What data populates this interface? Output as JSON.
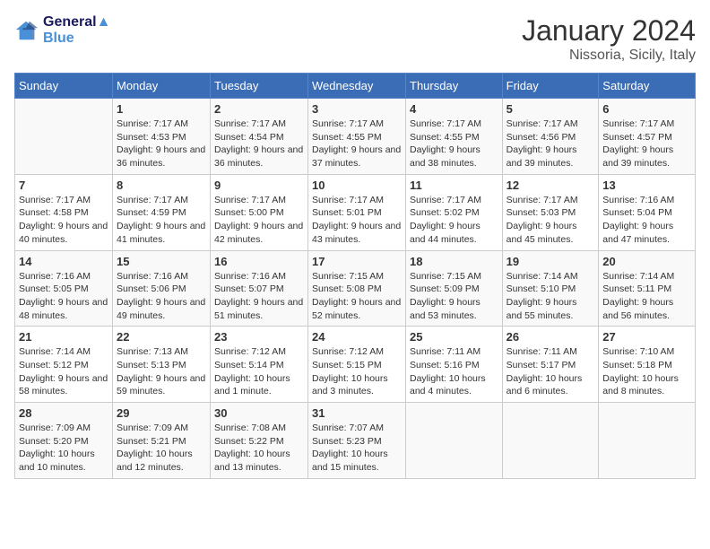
{
  "header": {
    "logo_line1": "General",
    "logo_line2": "Blue",
    "month": "January 2024",
    "location": "Nissoria, Sicily, Italy"
  },
  "weekdays": [
    "Sunday",
    "Monday",
    "Tuesday",
    "Wednesday",
    "Thursday",
    "Friday",
    "Saturday"
  ],
  "weeks": [
    [
      {
        "day": "",
        "sunrise": "",
        "sunset": "",
        "daylight": ""
      },
      {
        "day": "1",
        "sunrise": "Sunrise: 7:17 AM",
        "sunset": "Sunset: 4:53 PM",
        "daylight": "Daylight: 9 hours and 36 minutes."
      },
      {
        "day": "2",
        "sunrise": "Sunrise: 7:17 AM",
        "sunset": "Sunset: 4:54 PM",
        "daylight": "Daylight: 9 hours and 36 minutes."
      },
      {
        "day": "3",
        "sunrise": "Sunrise: 7:17 AM",
        "sunset": "Sunset: 4:55 PM",
        "daylight": "Daylight: 9 hours and 37 minutes."
      },
      {
        "day": "4",
        "sunrise": "Sunrise: 7:17 AM",
        "sunset": "Sunset: 4:55 PM",
        "daylight": "Daylight: 9 hours and 38 minutes."
      },
      {
        "day": "5",
        "sunrise": "Sunrise: 7:17 AM",
        "sunset": "Sunset: 4:56 PM",
        "daylight": "Daylight: 9 hours and 39 minutes."
      },
      {
        "day": "6",
        "sunrise": "Sunrise: 7:17 AM",
        "sunset": "Sunset: 4:57 PM",
        "daylight": "Daylight: 9 hours and 39 minutes."
      }
    ],
    [
      {
        "day": "7",
        "sunrise": "Sunrise: 7:17 AM",
        "sunset": "Sunset: 4:58 PM",
        "daylight": "Daylight: 9 hours and 40 minutes."
      },
      {
        "day": "8",
        "sunrise": "Sunrise: 7:17 AM",
        "sunset": "Sunset: 4:59 PM",
        "daylight": "Daylight: 9 hours and 41 minutes."
      },
      {
        "day": "9",
        "sunrise": "Sunrise: 7:17 AM",
        "sunset": "Sunset: 5:00 PM",
        "daylight": "Daylight: 9 hours and 42 minutes."
      },
      {
        "day": "10",
        "sunrise": "Sunrise: 7:17 AM",
        "sunset": "Sunset: 5:01 PM",
        "daylight": "Daylight: 9 hours and 43 minutes."
      },
      {
        "day": "11",
        "sunrise": "Sunrise: 7:17 AM",
        "sunset": "Sunset: 5:02 PM",
        "daylight": "Daylight: 9 hours and 44 minutes."
      },
      {
        "day": "12",
        "sunrise": "Sunrise: 7:17 AM",
        "sunset": "Sunset: 5:03 PM",
        "daylight": "Daylight: 9 hours and 45 minutes."
      },
      {
        "day": "13",
        "sunrise": "Sunrise: 7:16 AM",
        "sunset": "Sunset: 5:04 PM",
        "daylight": "Daylight: 9 hours and 47 minutes."
      }
    ],
    [
      {
        "day": "14",
        "sunrise": "Sunrise: 7:16 AM",
        "sunset": "Sunset: 5:05 PM",
        "daylight": "Daylight: 9 hours and 48 minutes."
      },
      {
        "day": "15",
        "sunrise": "Sunrise: 7:16 AM",
        "sunset": "Sunset: 5:06 PM",
        "daylight": "Daylight: 9 hours and 49 minutes."
      },
      {
        "day": "16",
        "sunrise": "Sunrise: 7:16 AM",
        "sunset": "Sunset: 5:07 PM",
        "daylight": "Daylight: 9 hours and 51 minutes."
      },
      {
        "day": "17",
        "sunrise": "Sunrise: 7:15 AM",
        "sunset": "Sunset: 5:08 PM",
        "daylight": "Daylight: 9 hours and 52 minutes."
      },
      {
        "day": "18",
        "sunrise": "Sunrise: 7:15 AM",
        "sunset": "Sunset: 5:09 PM",
        "daylight": "Daylight: 9 hours and 53 minutes."
      },
      {
        "day": "19",
        "sunrise": "Sunrise: 7:14 AM",
        "sunset": "Sunset: 5:10 PM",
        "daylight": "Daylight: 9 hours and 55 minutes."
      },
      {
        "day": "20",
        "sunrise": "Sunrise: 7:14 AM",
        "sunset": "Sunset: 5:11 PM",
        "daylight": "Daylight: 9 hours and 56 minutes."
      }
    ],
    [
      {
        "day": "21",
        "sunrise": "Sunrise: 7:14 AM",
        "sunset": "Sunset: 5:12 PM",
        "daylight": "Daylight: 9 hours and 58 minutes."
      },
      {
        "day": "22",
        "sunrise": "Sunrise: 7:13 AM",
        "sunset": "Sunset: 5:13 PM",
        "daylight": "Daylight: 9 hours and 59 minutes."
      },
      {
        "day": "23",
        "sunrise": "Sunrise: 7:12 AM",
        "sunset": "Sunset: 5:14 PM",
        "daylight": "Daylight: 10 hours and 1 minute."
      },
      {
        "day": "24",
        "sunrise": "Sunrise: 7:12 AM",
        "sunset": "Sunset: 5:15 PM",
        "daylight": "Daylight: 10 hours and 3 minutes."
      },
      {
        "day": "25",
        "sunrise": "Sunrise: 7:11 AM",
        "sunset": "Sunset: 5:16 PM",
        "daylight": "Daylight: 10 hours and 4 minutes."
      },
      {
        "day": "26",
        "sunrise": "Sunrise: 7:11 AM",
        "sunset": "Sunset: 5:17 PM",
        "daylight": "Daylight: 10 hours and 6 minutes."
      },
      {
        "day": "27",
        "sunrise": "Sunrise: 7:10 AM",
        "sunset": "Sunset: 5:18 PM",
        "daylight": "Daylight: 10 hours and 8 minutes."
      }
    ],
    [
      {
        "day": "28",
        "sunrise": "Sunrise: 7:09 AM",
        "sunset": "Sunset: 5:20 PM",
        "daylight": "Daylight: 10 hours and 10 minutes."
      },
      {
        "day": "29",
        "sunrise": "Sunrise: 7:09 AM",
        "sunset": "Sunset: 5:21 PM",
        "daylight": "Daylight: 10 hours and 12 minutes."
      },
      {
        "day": "30",
        "sunrise": "Sunrise: 7:08 AM",
        "sunset": "Sunset: 5:22 PM",
        "daylight": "Daylight: 10 hours and 13 minutes."
      },
      {
        "day": "31",
        "sunrise": "Sunrise: 7:07 AM",
        "sunset": "Sunset: 5:23 PM",
        "daylight": "Daylight: 10 hours and 15 minutes."
      },
      {
        "day": "",
        "sunrise": "",
        "sunset": "",
        "daylight": ""
      },
      {
        "day": "",
        "sunrise": "",
        "sunset": "",
        "daylight": ""
      },
      {
        "day": "",
        "sunrise": "",
        "sunset": "",
        "daylight": ""
      }
    ]
  ]
}
